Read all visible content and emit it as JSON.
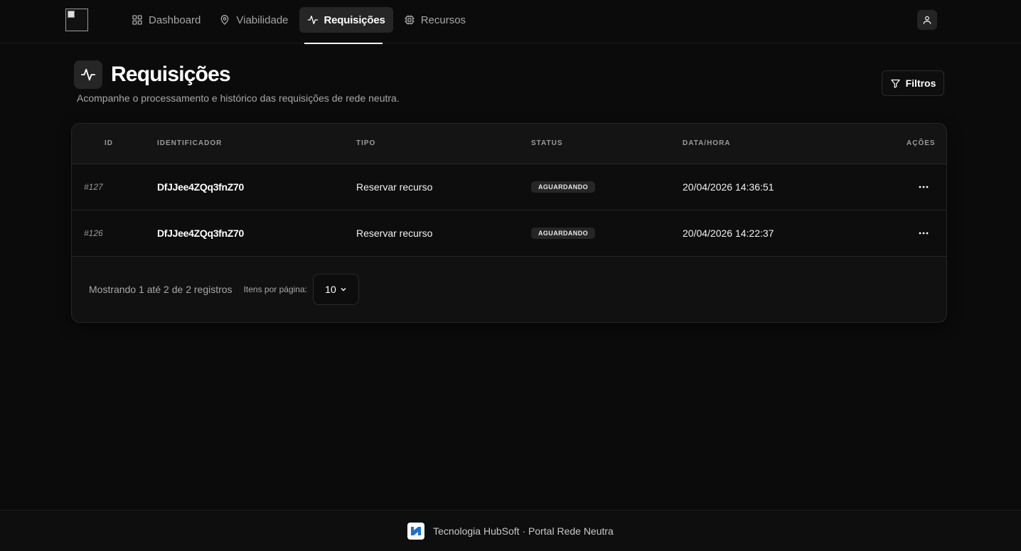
{
  "nav": {
    "items": [
      {
        "label": "Dashboard",
        "icon": "grid-icon"
      },
      {
        "label": "Viabilidade",
        "icon": "map-pin-icon"
      },
      {
        "label": "Requisições",
        "icon": "activity-icon",
        "active": true
      },
      {
        "label": "Recursos",
        "icon": "cpu-icon"
      }
    ]
  },
  "page": {
    "title": "Requisições",
    "subtitle": "Acompanhe o processamento e histórico das requisições de rede neutra.",
    "filter_label": "Filtros"
  },
  "table": {
    "headers": {
      "id": "ID",
      "identificador": "IDENTIFICADOR",
      "tipo": "TIPO",
      "status": "STATUS",
      "data": "DATA/HORA",
      "acoes": "AÇÕES"
    },
    "rows": [
      {
        "id": "#127",
        "identificador": "DfJJee4ZQq3fnZ70",
        "tipo": "Reservar recurso",
        "status": "AGUARDANDO",
        "data": "20/04/2026 14:36:51"
      },
      {
        "id": "#126",
        "identificador": "DfJJee4ZQq3fnZ70",
        "tipo": "Reservar recurso",
        "status": "AGUARDANDO",
        "data": "20/04/2026 14:22:37"
      }
    ]
  },
  "pagination": {
    "showing": "Mostrando 1 até 2 de 2 registros",
    "per_page_label": "Itens por página:",
    "per_page_value": "10"
  },
  "footer": {
    "text": "Tecnologia HubSoft · Portal Rede Neutra"
  },
  "colors": {
    "background": "#0b0b0b",
    "card": "#111111",
    "active_nav": "#262626"
  }
}
